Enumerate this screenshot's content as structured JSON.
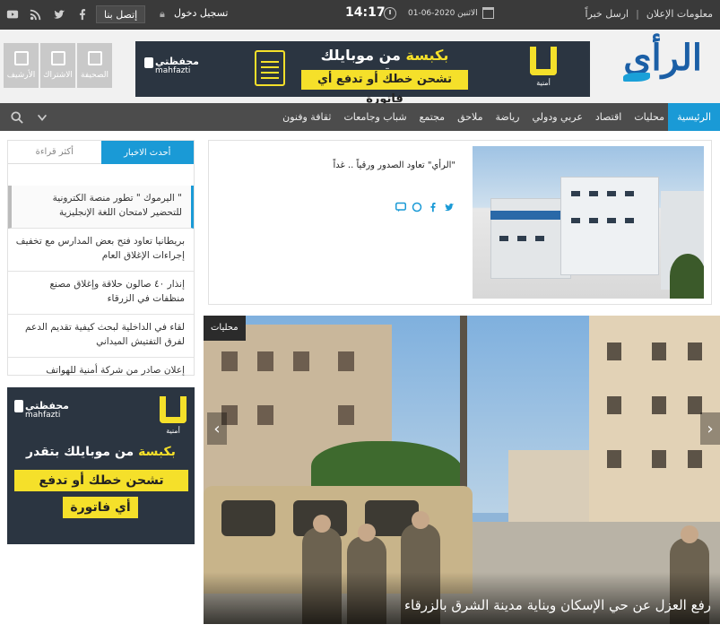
{
  "topbar": {
    "contact_label": "إتصل بنا",
    "login_label": "تسجيل دخول",
    "time": "14:17",
    "date": "الاثنين 2020-06-01",
    "send_news_label": "ارسل خبراً",
    "ads_info_label": "معلومات الإعلان",
    "separator": "|"
  },
  "header": {
    "archive_label": "الأرشيف",
    "subscriptions_label": "الاشتراك",
    "newspaper_label": "الصحيفة",
    "logo_text": "الرأي",
    "banner": {
      "brand_ar": "محفظتي",
      "brand_en": "mahfazti",
      "line1_pre": "بكبسة ",
      "line1_rest": "من موبايلك بتقدر",
      "line2": "تشحن خطك أو تدفع أي فاتورة",
      "u_text": "أمنية"
    }
  },
  "nav": {
    "home": "الرئيسية",
    "items": [
      "محليات",
      "اقتصاد",
      "عربي ودولي",
      "رياضة",
      "ملاحق",
      "مجتمع",
      "شباب وجامعات",
      "ثقافة وفنون"
    ]
  },
  "sidebar": {
    "tab_latest": "أحدث الاخبار",
    "tab_most_read": "أكثر قراءة",
    "news": [
      "\" اليرموك \" تطور منصة الكترونية للتحضير لامتحان اللغة الإنجليزية",
      "بريطانيا تعاود فتح بعض المدارس مع تخفيف إجراءات الإغلاق العام",
      "إنذار ٤٠ صالون حلاقة وإغلاق مصنع منظفات في الزرقاء",
      "لقاء في الداخلية لبحث كيفية تقديم الدعم لفرق التفتيش الميداني",
      "إعلان صادر من شركة أمنية للهواتف"
    ]
  },
  "side_ad": {
    "brand_ar": "محفظتي",
    "brand_en": "mahfazti",
    "u_text": "أمنية",
    "line1_pre": "بكبسة ",
    "line1_rest": "من موبايلك بتقدر",
    "line2": "تشحن خطك أو تدفع",
    "line3": "أي فاتورة"
  },
  "feature": {
    "title": "\"الرأي\" تعاود الصدور ورقياً .. غداً"
  },
  "hero": {
    "category": "محليات",
    "caption": "رفع العزل عن حي الإسكان وبناية مدينة الشرق بالزرقاء",
    "prev": "‹",
    "next": "›"
  },
  "colors": {
    "accent": "#1a9ad6",
    "topbar": "#3a3a3a",
    "nav": "#4c4c4c",
    "ad_bg": "#2b3541",
    "ad_yellow": "#f5e02a"
  }
}
